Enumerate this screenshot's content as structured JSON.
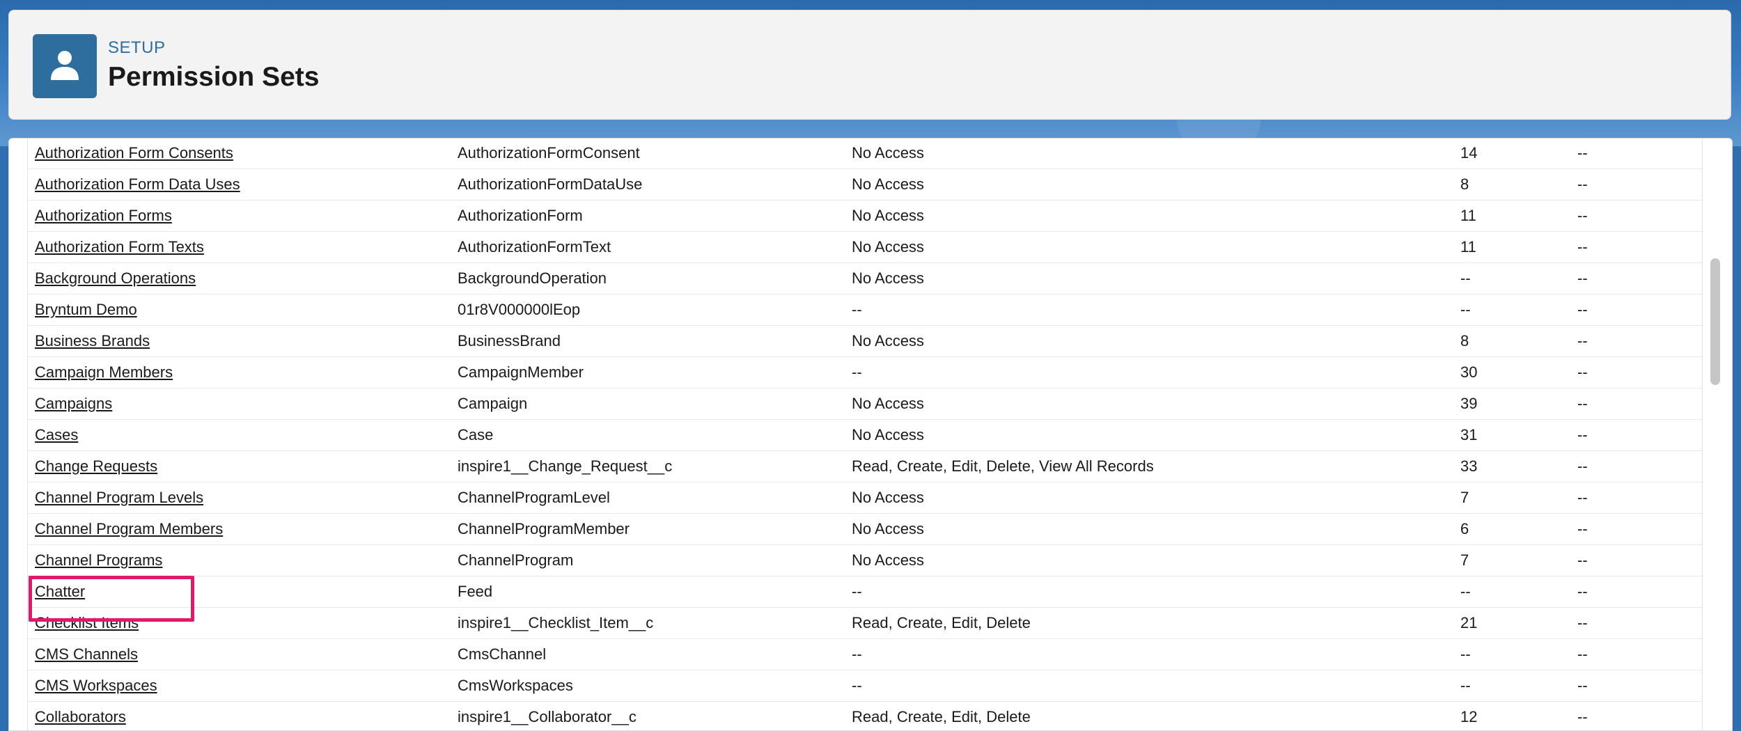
{
  "header": {
    "setup_label": "SETUP",
    "title": "Permission Sets",
    "icon": "user-icon"
  },
  "table": {
    "rows": [
      {
        "label": "Authorization Form Consents",
        "api": "AuthorizationFormConsent",
        "perm": "No Access",
        "count": "14",
        "extra": "--"
      },
      {
        "label": "Authorization Form Data Uses",
        "api": "AuthorizationFormDataUse",
        "perm": "No Access",
        "count": "8",
        "extra": "--"
      },
      {
        "label": "Authorization Forms",
        "api": "AuthorizationForm",
        "perm": "No Access",
        "count": "11",
        "extra": "--"
      },
      {
        "label": "Authorization Form Texts",
        "api": "AuthorizationFormText",
        "perm": "No Access",
        "count": "11",
        "extra": "--"
      },
      {
        "label": "Background Operations",
        "api": "BackgroundOperation",
        "perm": "No Access",
        "count": "--",
        "extra": "--"
      },
      {
        "label": "Bryntum Demo",
        "api": "01r8V000000lEop",
        "perm": "--",
        "count": "--",
        "extra": "--"
      },
      {
        "label": "Business Brands",
        "api": "BusinessBrand",
        "perm": "No Access",
        "count": "8",
        "extra": "--"
      },
      {
        "label": "Campaign Members",
        "api": "CampaignMember",
        "perm": "--",
        "count": "30",
        "extra": "--"
      },
      {
        "label": "Campaigns",
        "api": "Campaign",
        "perm": "No Access",
        "count": "39",
        "extra": "--"
      },
      {
        "label": "Cases",
        "api": "Case",
        "perm": "No Access",
        "count": "31",
        "extra": "--"
      },
      {
        "label": "Change Requests",
        "api": "inspire1__Change_Request__c",
        "perm": "Read, Create, Edit, Delete, View All Records",
        "count": "33",
        "extra": "--"
      },
      {
        "label": "Channel Program Levels",
        "api": "ChannelProgramLevel",
        "perm": "No Access",
        "count": "7",
        "extra": "--"
      },
      {
        "label": "Channel Program Members",
        "api": "ChannelProgramMember",
        "perm": "No Access",
        "count": "6",
        "extra": "--"
      },
      {
        "label": "Channel Programs",
        "api": "ChannelProgram",
        "perm": "No Access",
        "count": "7",
        "extra": "--"
      },
      {
        "label": "Chatter",
        "api": "Feed",
        "perm": "--",
        "count": "--",
        "extra": "--"
      },
      {
        "label": "Checklist Items",
        "api": "inspire1__Checklist_Item__c",
        "perm": "Read, Create, Edit, Delete",
        "count": "21",
        "extra": "--"
      },
      {
        "label": "CMS Channels",
        "api": "CmsChannel",
        "perm": "--",
        "count": "--",
        "extra": "--"
      },
      {
        "label": "CMS Workspaces",
        "api": "CmsWorkspaces",
        "perm": "--",
        "count": "--",
        "extra": "--"
      },
      {
        "label": "Collaborators",
        "api": "inspire1__Collaborator__c",
        "perm": "Read, Create, Edit, Delete",
        "count": "12",
        "extra": "--"
      }
    ]
  },
  "colors": {
    "brand": "#2e6e9e",
    "highlight": "#e0196e"
  }
}
